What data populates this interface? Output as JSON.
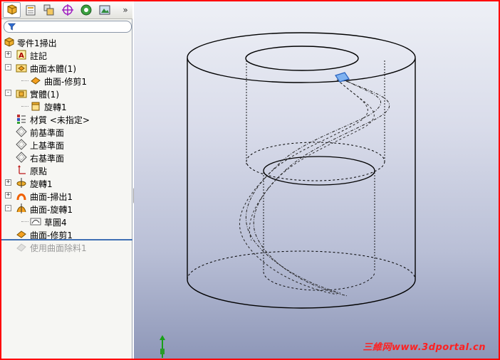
{
  "toolbar": {
    "tabs": [
      {
        "name": "feature-manager-icon"
      },
      {
        "name": "property-manager-icon"
      },
      {
        "name": "configuration-manager-icon"
      },
      {
        "name": "dimxpert-icon"
      },
      {
        "name": "display-manager-icon"
      },
      {
        "name": "appearance-icon"
      }
    ],
    "more": "»"
  },
  "tree": {
    "items": [
      {
        "label": "零件1掃出",
        "icon": "part-icon",
        "expander": "",
        "indent": 0
      },
      {
        "label": "註記",
        "icon": "annotation-icon",
        "expander": "+",
        "indent": 1
      },
      {
        "label": "曲面本體(1)",
        "icon": "surface-bodies-folder-icon",
        "expander": "−",
        "indent": 1
      },
      {
        "label": "曲面-修剪1",
        "icon": "surface-trim-icon",
        "expander": "",
        "indent": 2
      },
      {
        "label": "實體(1)",
        "icon": "solid-bodies-folder-icon",
        "expander": "−",
        "indent": 1
      },
      {
        "label": "旋轉1",
        "icon": "solid-body-icon",
        "expander": "",
        "indent": 2
      },
      {
        "label": "材質 <未指定>",
        "icon": "material-icon",
        "expander": "",
        "indent": 1
      },
      {
        "label": "前基準面",
        "icon": "plane-icon",
        "expander": "",
        "indent": 1
      },
      {
        "label": "上基準面",
        "icon": "plane-icon",
        "expander": "",
        "indent": 1
      },
      {
        "label": "右基準面",
        "icon": "plane-icon",
        "expander": "",
        "indent": 1
      },
      {
        "label": "原點",
        "icon": "origin-icon",
        "expander": "",
        "indent": 1
      },
      {
        "label": "旋轉1",
        "icon": "revolve-icon",
        "expander": "+",
        "indent": 1
      },
      {
        "label": "曲面-掃出1",
        "icon": "surface-sweep-icon",
        "expander": "+",
        "indent": 1
      },
      {
        "label": "曲面-旋轉1",
        "icon": "surface-revolve-icon",
        "expander": "−",
        "indent": 1
      },
      {
        "label": "草圖4",
        "icon": "sketch-icon",
        "expander": "",
        "indent": 2
      },
      {
        "label": "曲面-修剪1",
        "icon": "surface-trim-icon",
        "expander": "",
        "indent": 1
      },
      {
        "label": "使用曲面除料1",
        "icon": "surface-cut-icon",
        "expander": "",
        "indent": 1,
        "suppressed": true
      }
    ]
  },
  "watermark": "三維网www.3dportal.cn",
  "colors": {
    "frame": "#ff0000",
    "rollback_bar": "#3f6fb4",
    "selection": "#3a7bd5"
  }
}
